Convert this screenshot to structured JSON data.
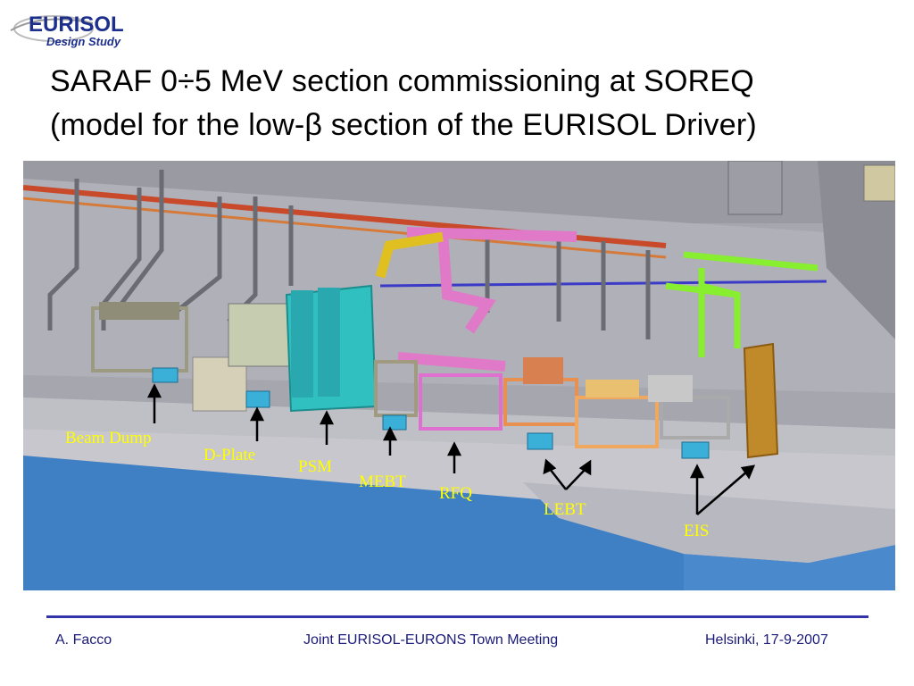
{
  "logo": {
    "text": "EURISOL",
    "subtitle": "Design Study"
  },
  "title": {
    "line1": "SARAF 0÷5 MeV section commissioning at SOREQ",
    "line2": "(model for the low-β section of the EURISOL Driver)"
  },
  "labels": {
    "beam_dump": "Beam Dump",
    "d_plate": "D-Plate",
    "psm": "PSM",
    "mebt": "MEBT",
    "rfq": "RFQ",
    "lebt": "LEBT",
    "eis": "EIS"
  },
  "footer": {
    "author": "A. Facco",
    "event": "Joint EURISOL-EURONS Town Meeting",
    "place_date": "Helsinki, 17-9-2007"
  },
  "colors": {
    "label": "#ffff00",
    "footer_text": "#1a1a7a",
    "footer_rule": "#3333aa",
    "floor_blue": "#3f7fc4"
  }
}
